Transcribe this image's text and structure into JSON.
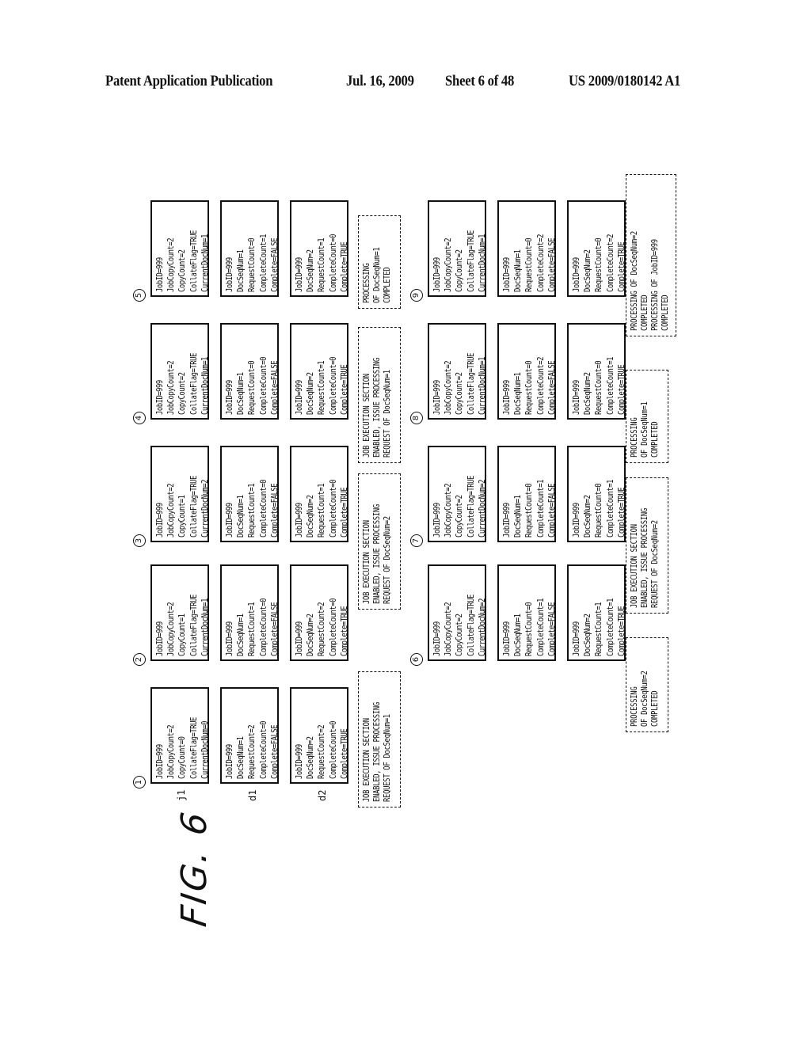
{
  "header": {
    "publication": "Patent Application Publication",
    "date": "Jul. 16, 2009",
    "sheet": "Sheet 6 of 48",
    "number": "US 2009/0180142 A1"
  },
  "figure": {
    "label": "FIG. 6",
    "row_labels": [
      "j1",
      "d1",
      "d2"
    ],
    "panels": [
      {
        "step": "1",
        "j1": [
          "JobID=999",
          "JobCopyCount=2",
          "CopyCount=0",
          "CollateFlag=TRUE",
          "CurrentDocNum=0"
        ],
        "d1": [
          "JobID=999",
          "DocSeqNum=1",
          "RequestCount=2",
          "CompleteCount=0",
          "Complete=FALSE"
        ],
        "d2": [
          "JobID=999",
          "DocSeqNum=2",
          "RequestCount=2",
          "CompleteCount=0",
          "Complete=TRUE"
        ]
      },
      {
        "step": "2",
        "j1": [
          "JobID=999",
          "JobCopyCount=2",
          "CopyCount=1",
          "CollateFlag=TRUE",
          "CurrentDocNum=1"
        ],
        "d1": [
          "JobID=999",
          "DocSeqNum=1",
          "RequestCount=1",
          "CompleteCount=0",
          "Complete=FALSE"
        ],
        "d2": [
          "JobID=999",
          "DocSeqNum=2",
          "RequestCount=2",
          "CompleteCount=0",
          "Complete=TRUE"
        ]
      },
      {
        "step": "3",
        "j1": [
          "JobID=999",
          "JobCopyCount=2",
          "CopyCount=1",
          "CollateFlag=TRUE",
          "CurrentDocNum=2"
        ],
        "d1": [
          "JobID=999",
          "DocSeqNum=1",
          "RequestCount=1",
          "CompleteCount=0",
          "Complete=FALSE"
        ],
        "d2": [
          "JobID=999",
          "DocSeqNum=2",
          "RequestCount=1",
          "CompleteCount=0",
          "Complete=TRUE"
        ]
      },
      {
        "step": "4",
        "j1": [
          "JobID=999",
          "JobCopyCount=2",
          "CopyCount=2",
          "CollateFlag=TRUE",
          "CurrentDocNum=1"
        ],
        "d1": [
          "JobID=999",
          "DocSeqNum=1",
          "RequestCount=0",
          "CompleteCount=0",
          "Complete=FALSE"
        ],
        "d2": [
          "JobID=999",
          "DocSeqNum=2",
          "RequestCount=1",
          "CompleteCount=0",
          "Complete=TRUE"
        ]
      },
      {
        "step": "5",
        "j1": [
          "JobID=999",
          "JobCopyCount=2",
          "CopyCount=2",
          "CollateFlag=TRUE",
          "CurrentDocNum=1"
        ],
        "d1": [
          "JobID=999",
          "DocSeqNum=1",
          "RequestCount=0",
          "CompleteCount=1",
          "Complete=FALSE"
        ],
        "d2": [
          "JobID=999",
          "DocSeqNum=2",
          "RequestCount=1",
          "CompleteCount=0",
          "Complete=TRUE"
        ]
      },
      {
        "step": "6",
        "j1": [
          "JobID=999",
          "JobCopyCount=2",
          "CopyCount=2",
          "CollateFlag=TRUE",
          "CurrentDocNum=2"
        ],
        "d1": [
          "JobID=999",
          "DocSeqNum=1",
          "RequestCount=0",
          "CompleteCount=1",
          "Complete=FALSE"
        ],
        "d2": [
          "JobID=999",
          "DocSeqNum=2",
          "RequestCount=1",
          "CompleteCount=1",
          "Complete=TRUE"
        ]
      },
      {
        "step": "7",
        "j1": [
          "JobID=999",
          "JobCopyCount=2",
          "CopyCount=2",
          "CollateFlag=TRUE",
          "CurrentDocNum=2"
        ],
        "d1": [
          "JobID=999",
          "DocSeqNum=1",
          "RequestCount=0",
          "CompleteCount=1",
          "Complete=FALSE"
        ],
        "d2": [
          "JobID=999",
          "DocSeqNum=2",
          "RequestCount=0",
          "CompleteCount=1",
          "Complete=TRUE"
        ]
      },
      {
        "step": "8",
        "j1": [
          "JobID=999",
          "JobCopyCount=2",
          "CopyCount=2",
          "CollateFlag=TRUE",
          "CurrentDocNum=1"
        ],
        "d1": [
          "JobID=999",
          "DocSeqNum=1",
          "RequestCount=0",
          "CompleteCount=2",
          "Complete=FALSE"
        ],
        "d2": [
          "JobID=999",
          "DocSeqNum=2",
          "RequestCount=0",
          "CompleteCount=1",
          "Complete=TRUE"
        ]
      },
      {
        "step": "9",
        "j1": [
          "JobID=999",
          "JobCopyCount=2",
          "CopyCount=2",
          "CollateFlag=TRUE",
          "CurrentDocNum=1"
        ],
        "d1": [
          "JobID=999",
          "DocSeqNum=1",
          "RequestCount=0",
          "CompleteCount=2",
          "Complete=FALSE"
        ],
        "d2": [
          "JobID=999",
          "DocSeqNum=2",
          "RequestCount=0",
          "CompleteCount=2",
          "Complete=TRUE"
        ]
      }
    ],
    "notes": [
      {
        "lines": [
          "JOB EXECUTION SECTION",
          "ENABLED, ISSUE PROCESSING",
          "REQUEST OF DocSeqNum=1"
        ]
      },
      {
        "lines": [
          "JOB EXECUTION SECTION",
          "ENABLED, ISSUE PROCESSING",
          "REQUEST OF DocSeqNum=2"
        ]
      },
      {
        "lines": [
          "JOB EXECUTION SECTION",
          "ENABLED, ISSUE PROCESSING",
          "REQUEST OF DocSeqNum=1"
        ]
      },
      {
        "lines": [
          "PROCESSING",
          "OF DocSeqNum=1",
          "COMPLETED"
        ]
      },
      {
        "lines": [
          "PROCESSING",
          "OF DocSeqNum=2",
          "COMPLETED"
        ]
      },
      {
        "lines": [
          "JOB EXECUTION SECTION",
          "ENABLED, ISSUE PROCESSING",
          "REQUEST OF DocSeqNum=2"
        ]
      },
      {
        "lines": [
          "PROCESSING",
          "OF DocSeqNum=1",
          "COMPLETED"
        ]
      },
      {
        "lines": [
          "PROCESSING OF DocSeqNum=2",
          "COMPLETED",
          "PROCESSING OF JobID=999",
          "COMPLETED"
        ]
      }
    ]
  }
}
